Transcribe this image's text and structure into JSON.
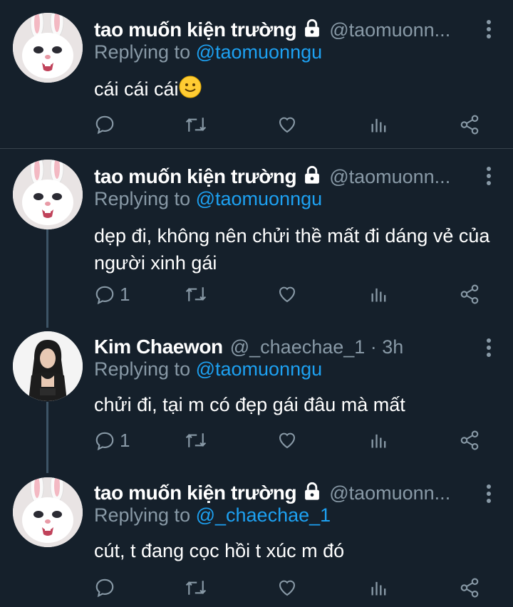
{
  "tweets": [
    {
      "name": "tao muốn kiện trường",
      "handle": "@taomuonn...",
      "replying_label": "Replying to ",
      "replying_to": "@taomuonngu",
      "text": "cái cái cái",
      "reply_count": ""
    },
    {
      "name": "tao muốn kiện trường",
      "handle": "@taomuonn...",
      "replying_label": "Replying to ",
      "replying_to": "@taomuonngu",
      "text": "dẹp đi, không nên chửi thề mất đi dáng vẻ của người xinh gái",
      "reply_count": "1"
    },
    {
      "name": "Kim Chaewon",
      "handle": "@_chaechae_1 · 3h",
      "replying_label": "Replying to ",
      "replying_to": "@taomuonngu",
      "text": "chửi đi, tại m có đẹp gái đâu mà mất",
      "reply_count": "1"
    },
    {
      "name": "tao muốn kiện trường",
      "handle": "@taomuonn...",
      "replying_label": "Replying to ",
      "replying_to": "@_chaechae_1",
      "text": "cút, t đang cọc hồi t xúc m đó",
      "reply_count": ""
    }
  ],
  "colors": {
    "background": "#15202b",
    "secondary_text": "#8899a6",
    "mention": "#1da1f2",
    "divider": "#38444d"
  },
  "icons": [
    "lock-icon",
    "more-icon",
    "reply-icon",
    "retweet-icon",
    "like-icon",
    "analytics-icon",
    "share-icon",
    "smile-emoji"
  ]
}
